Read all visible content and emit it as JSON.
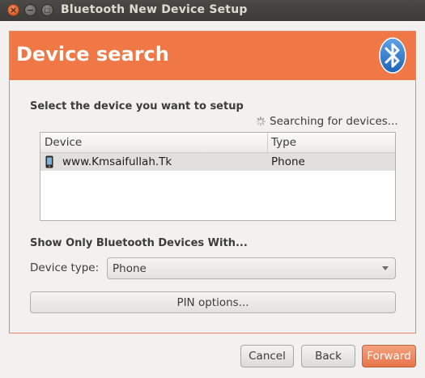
{
  "window": {
    "title": "Bluetooth New Device Setup"
  },
  "header": {
    "title": "Device search",
    "icon": "bluetooth-icon"
  },
  "device_section": {
    "label": "Select the device you want to setup",
    "status": "Searching for devices...",
    "columns": [
      "Device",
      "Type"
    ],
    "rows": [
      {
        "icon": "phone-icon",
        "device": "www.Kmsaifullah.Tk",
        "type": "Phone"
      }
    ]
  },
  "filter_section": {
    "label": "Show Only Bluetooth Devices With...",
    "device_type_label": "Device type:",
    "device_type_value": "Phone",
    "pin_button": "PIN options..."
  },
  "footer": {
    "cancel": "Cancel",
    "back": "Back",
    "forward": "Forward"
  },
  "colors": {
    "accent": "#f07746",
    "titlebar": "#3c3b37",
    "background": "#f2f1f0",
    "selected_row": "#e2e0de"
  }
}
